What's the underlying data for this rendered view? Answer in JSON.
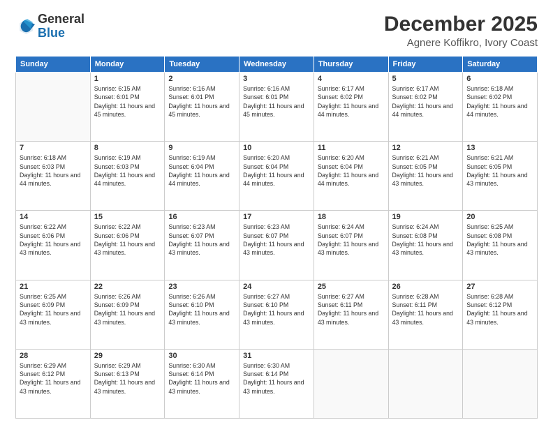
{
  "logo": {
    "general": "General",
    "blue": "Blue"
  },
  "header": {
    "month": "December 2025",
    "location": "Agnere Koffikro, Ivory Coast"
  },
  "days_of_week": [
    "Sunday",
    "Monday",
    "Tuesday",
    "Wednesday",
    "Thursday",
    "Friday",
    "Saturday"
  ],
  "weeks": [
    [
      {
        "day": "",
        "info": ""
      },
      {
        "day": "1",
        "info": "Sunrise: 6:15 AM\nSunset: 6:01 PM\nDaylight: 11 hours and 45 minutes."
      },
      {
        "day": "2",
        "info": "Sunrise: 6:16 AM\nSunset: 6:01 PM\nDaylight: 11 hours and 45 minutes."
      },
      {
        "day": "3",
        "info": "Sunrise: 6:16 AM\nSunset: 6:01 PM\nDaylight: 11 hours and 45 minutes."
      },
      {
        "day": "4",
        "info": "Sunrise: 6:17 AM\nSunset: 6:02 PM\nDaylight: 11 hours and 44 minutes."
      },
      {
        "day": "5",
        "info": "Sunrise: 6:17 AM\nSunset: 6:02 PM\nDaylight: 11 hours and 44 minutes."
      },
      {
        "day": "6",
        "info": "Sunrise: 6:18 AM\nSunset: 6:02 PM\nDaylight: 11 hours and 44 minutes."
      }
    ],
    [
      {
        "day": "7",
        "info": "Sunrise: 6:18 AM\nSunset: 6:03 PM\nDaylight: 11 hours and 44 minutes."
      },
      {
        "day": "8",
        "info": "Sunrise: 6:19 AM\nSunset: 6:03 PM\nDaylight: 11 hours and 44 minutes."
      },
      {
        "day": "9",
        "info": "Sunrise: 6:19 AM\nSunset: 6:04 PM\nDaylight: 11 hours and 44 minutes."
      },
      {
        "day": "10",
        "info": "Sunrise: 6:20 AM\nSunset: 6:04 PM\nDaylight: 11 hours and 44 minutes."
      },
      {
        "day": "11",
        "info": "Sunrise: 6:20 AM\nSunset: 6:04 PM\nDaylight: 11 hours and 44 minutes."
      },
      {
        "day": "12",
        "info": "Sunrise: 6:21 AM\nSunset: 6:05 PM\nDaylight: 11 hours and 43 minutes."
      },
      {
        "day": "13",
        "info": "Sunrise: 6:21 AM\nSunset: 6:05 PM\nDaylight: 11 hours and 43 minutes."
      }
    ],
    [
      {
        "day": "14",
        "info": "Sunrise: 6:22 AM\nSunset: 6:06 PM\nDaylight: 11 hours and 43 minutes."
      },
      {
        "day": "15",
        "info": "Sunrise: 6:22 AM\nSunset: 6:06 PM\nDaylight: 11 hours and 43 minutes."
      },
      {
        "day": "16",
        "info": "Sunrise: 6:23 AM\nSunset: 6:07 PM\nDaylight: 11 hours and 43 minutes."
      },
      {
        "day": "17",
        "info": "Sunrise: 6:23 AM\nSunset: 6:07 PM\nDaylight: 11 hours and 43 minutes."
      },
      {
        "day": "18",
        "info": "Sunrise: 6:24 AM\nSunset: 6:07 PM\nDaylight: 11 hours and 43 minutes."
      },
      {
        "day": "19",
        "info": "Sunrise: 6:24 AM\nSunset: 6:08 PM\nDaylight: 11 hours and 43 minutes."
      },
      {
        "day": "20",
        "info": "Sunrise: 6:25 AM\nSunset: 6:08 PM\nDaylight: 11 hours and 43 minutes."
      }
    ],
    [
      {
        "day": "21",
        "info": "Sunrise: 6:25 AM\nSunset: 6:09 PM\nDaylight: 11 hours and 43 minutes."
      },
      {
        "day": "22",
        "info": "Sunrise: 6:26 AM\nSunset: 6:09 PM\nDaylight: 11 hours and 43 minutes."
      },
      {
        "day": "23",
        "info": "Sunrise: 6:26 AM\nSunset: 6:10 PM\nDaylight: 11 hours and 43 minutes."
      },
      {
        "day": "24",
        "info": "Sunrise: 6:27 AM\nSunset: 6:10 PM\nDaylight: 11 hours and 43 minutes."
      },
      {
        "day": "25",
        "info": "Sunrise: 6:27 AM\nSunset: 6:11 PM\nDaylight: 11 hours and 43 minutes."
      },
      {
        "day": "26",
        "info": "Sunrise: 6:28 AM\nSunset: 6:11 PM\nDaylight: 11 hours and 43 minutes."
      },
      {
        "day": "27",
        "info": "Sunrise: 6:28 AM\nSunset: 6:12 PM\nDaylight: 11 hours and 43 minutes."
      }
    ],
    [
      {
        "day": "28",
        "info": "Sunrise: 6:29 AM\nSunset: 6:12 PM\nDaylight: 11 hours and 43 minutes."
      },
      {
        "day": "29",
        "info": "Sunrise: 6:29 AM\nSunset: 6:13 PM\nDaylight: 11 hours and 43 minutes."
      },
      {
        "day": "30",
        "info": "Sunrise: 6:30 AM\nSunset: 6:14 PM\nDaylight: 11 hours and 43 minutes."
      },
      {
        "day": "31",
        "info": "Sunrise: 6:30 AM\nSunset: 6:14 PM\nDaylight: 11 hours and 43 minutes."
      },
      {
        "day": "",
        "info": ""
      },
      {
        "day": "",
        "info": ""
      },
      {
        "day": "",
        "info": ""
      }
    ]
  ]
}
